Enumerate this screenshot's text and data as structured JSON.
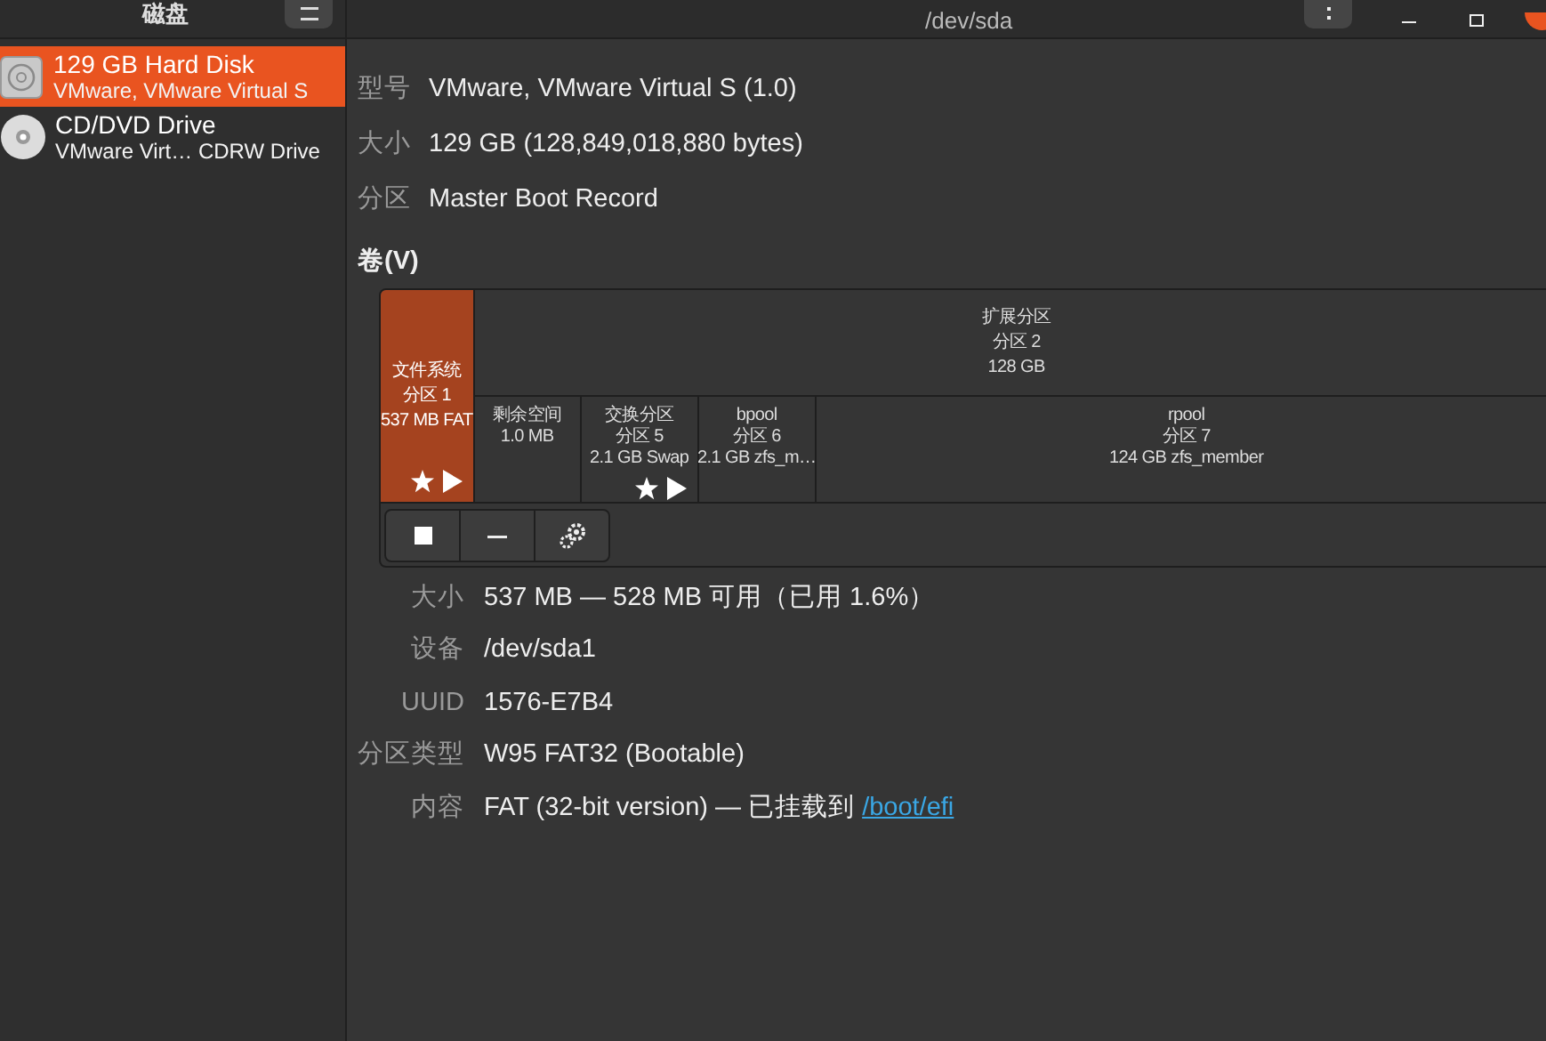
{
  "header": {
    "sidebar_title": "磁盘",
    "title": "/dev/sda"
  },
  "drives": [
    {
      "name": "129 GB Hard Disk",
      "model": "VMware, VMware Virtual S",
      "kind": "hdd",
      "selected": true
    },
    {
      "name": "CD/DVD Drive",
      "model": "VMware Virt… CDRW Drive",
      "kind": "optical",
      "selected": false
    }
  ],
  "drive_info": [
    {
      "label": "型号",
      "value": "VMware, VMware Virtual S (1.0)"
    },
    {
      "label": "大小",
      "value": "129 GB (128,849,018,880 bytes)"
    },
    {
      "label": "分区",
      "value": "Master Boot Record"
    }
  ],
  "volumes_heading": "卷(V)",
  "partitions": [
    {
      "kind": "volume",
      "lines": [
        "文件系统",
        "分区 1",
        "537 MB FAT"
      ],
      "selected": true,
      "bootable": true,
      "mounted": true
    },
    {
      "kind": "extended",
      "lines": [
        "扩展分区",
        "分区 2",
        "128 GB"
      ],
      "selected": false,
      "children": [
        {
          "lines": [
            "剩余空间",
            "1.0 MB"
          ],
          "selected": false,
          "bootable": false,
          "mounted": false
        },
        {
          "lines": [
            "交换分区",
            "分区 5",
            "2.1 GB Swap"
          ],
          "selected": false,
          "bootable": true,
          "mounted": true
        },
        {
          "lines": [
            "bpool",
            "分区 6",
            "2.1 GB zfs_m…"
          ],
          "selected": false,
          "bootable": false,
          "mounted": false
        },
        {
          "lines": [
            "rpool",
            "分区 7",
            "124 GB zfs_member"
          ],
          "selected": false,
          "bootable": false,
          "mounted": false
        }
      ]
    }
  ],
  "volume_tools": [
    {
      "kind": "stop"
    },
    {
      "kind": "delete"
    },
    {
      "kind": "settings"
    }
  ],
  "volume_info": [
    {
      "label": "大小",
      "value": "537 MB — 528 MB 可用（已用 1.6%）"
    },
    {
      "label": "设备",
      "value": "/dev/sda1"
    },
    {
      "label": "UUID",
      "value": "1576-E7B4"
    },
    {
      "label": "分区类型",
      "value": "W95 FAT32 (Bootable)"
    },
    {
      "label": "内容",
      "value": "FAT (32-bit version) — 已挂载到 ",
      "link": "/boot/efi"
    }
  ]
}
